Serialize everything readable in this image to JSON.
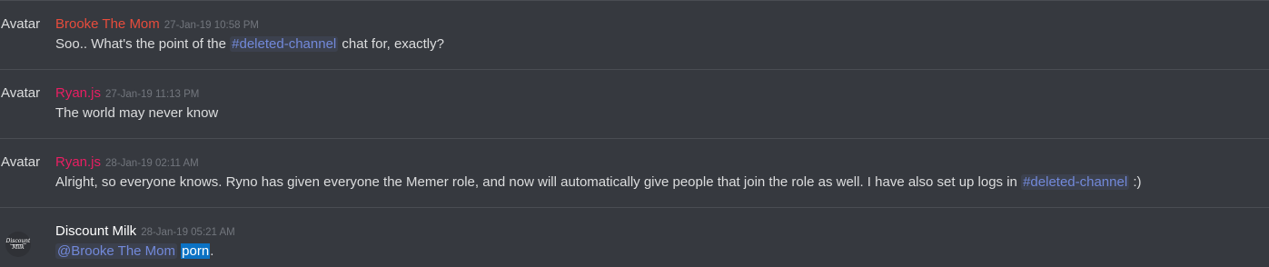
{
  "messages": [
    {
      "avatar_text": "Avatar",
      "username": "Brooke The Mom",
      "username_color": "#e74c3c",
      "timestamp": "27-Jan-19 10:58 PM",
      "content": {
        "before": "Soo.. What's the point of the ",
        "channel": "#deleted-channel",
        "after": " chat for, exactly?"
      }
    },
    {
      "avatar_text": "Avatar",
      "username": "Ryan.js",
      "username_color": "#e91e63",
      "timestamp": "27-Jan-19 11:13 PM",
      "content": {
        "text": "The world may never know"
      }
    },
    {
      "avatar_text": "Avatar",
      "username": "Ryan.js",
      "username_color": "#e91e63",
      "timestamp": "28-Jan-19 02:11 AM",
      "content": {
        "before": "Alright, so everyone knows. Ryno has given everyone the Memer role, and now will automatically give people that join the role as well. I have also set up logs in ",
        "channel": "#deleted-channel",
        "after": " :)"
      }
    },
    {
      "avatar_icon": "discount-milk-logo-icon",
      "avatar_logo_text": "Discount Milk",
      "username": "Discount Milk",
      "username_color": "#ffffff",
      "timestamp": "28-Jan-19 05:21 AM",
      "content": {
        "mention": "@Brooke The Mom",
        "space": " ",
        "highlighted": "porn",
        "after": "."
      }
    }
  ]
}
